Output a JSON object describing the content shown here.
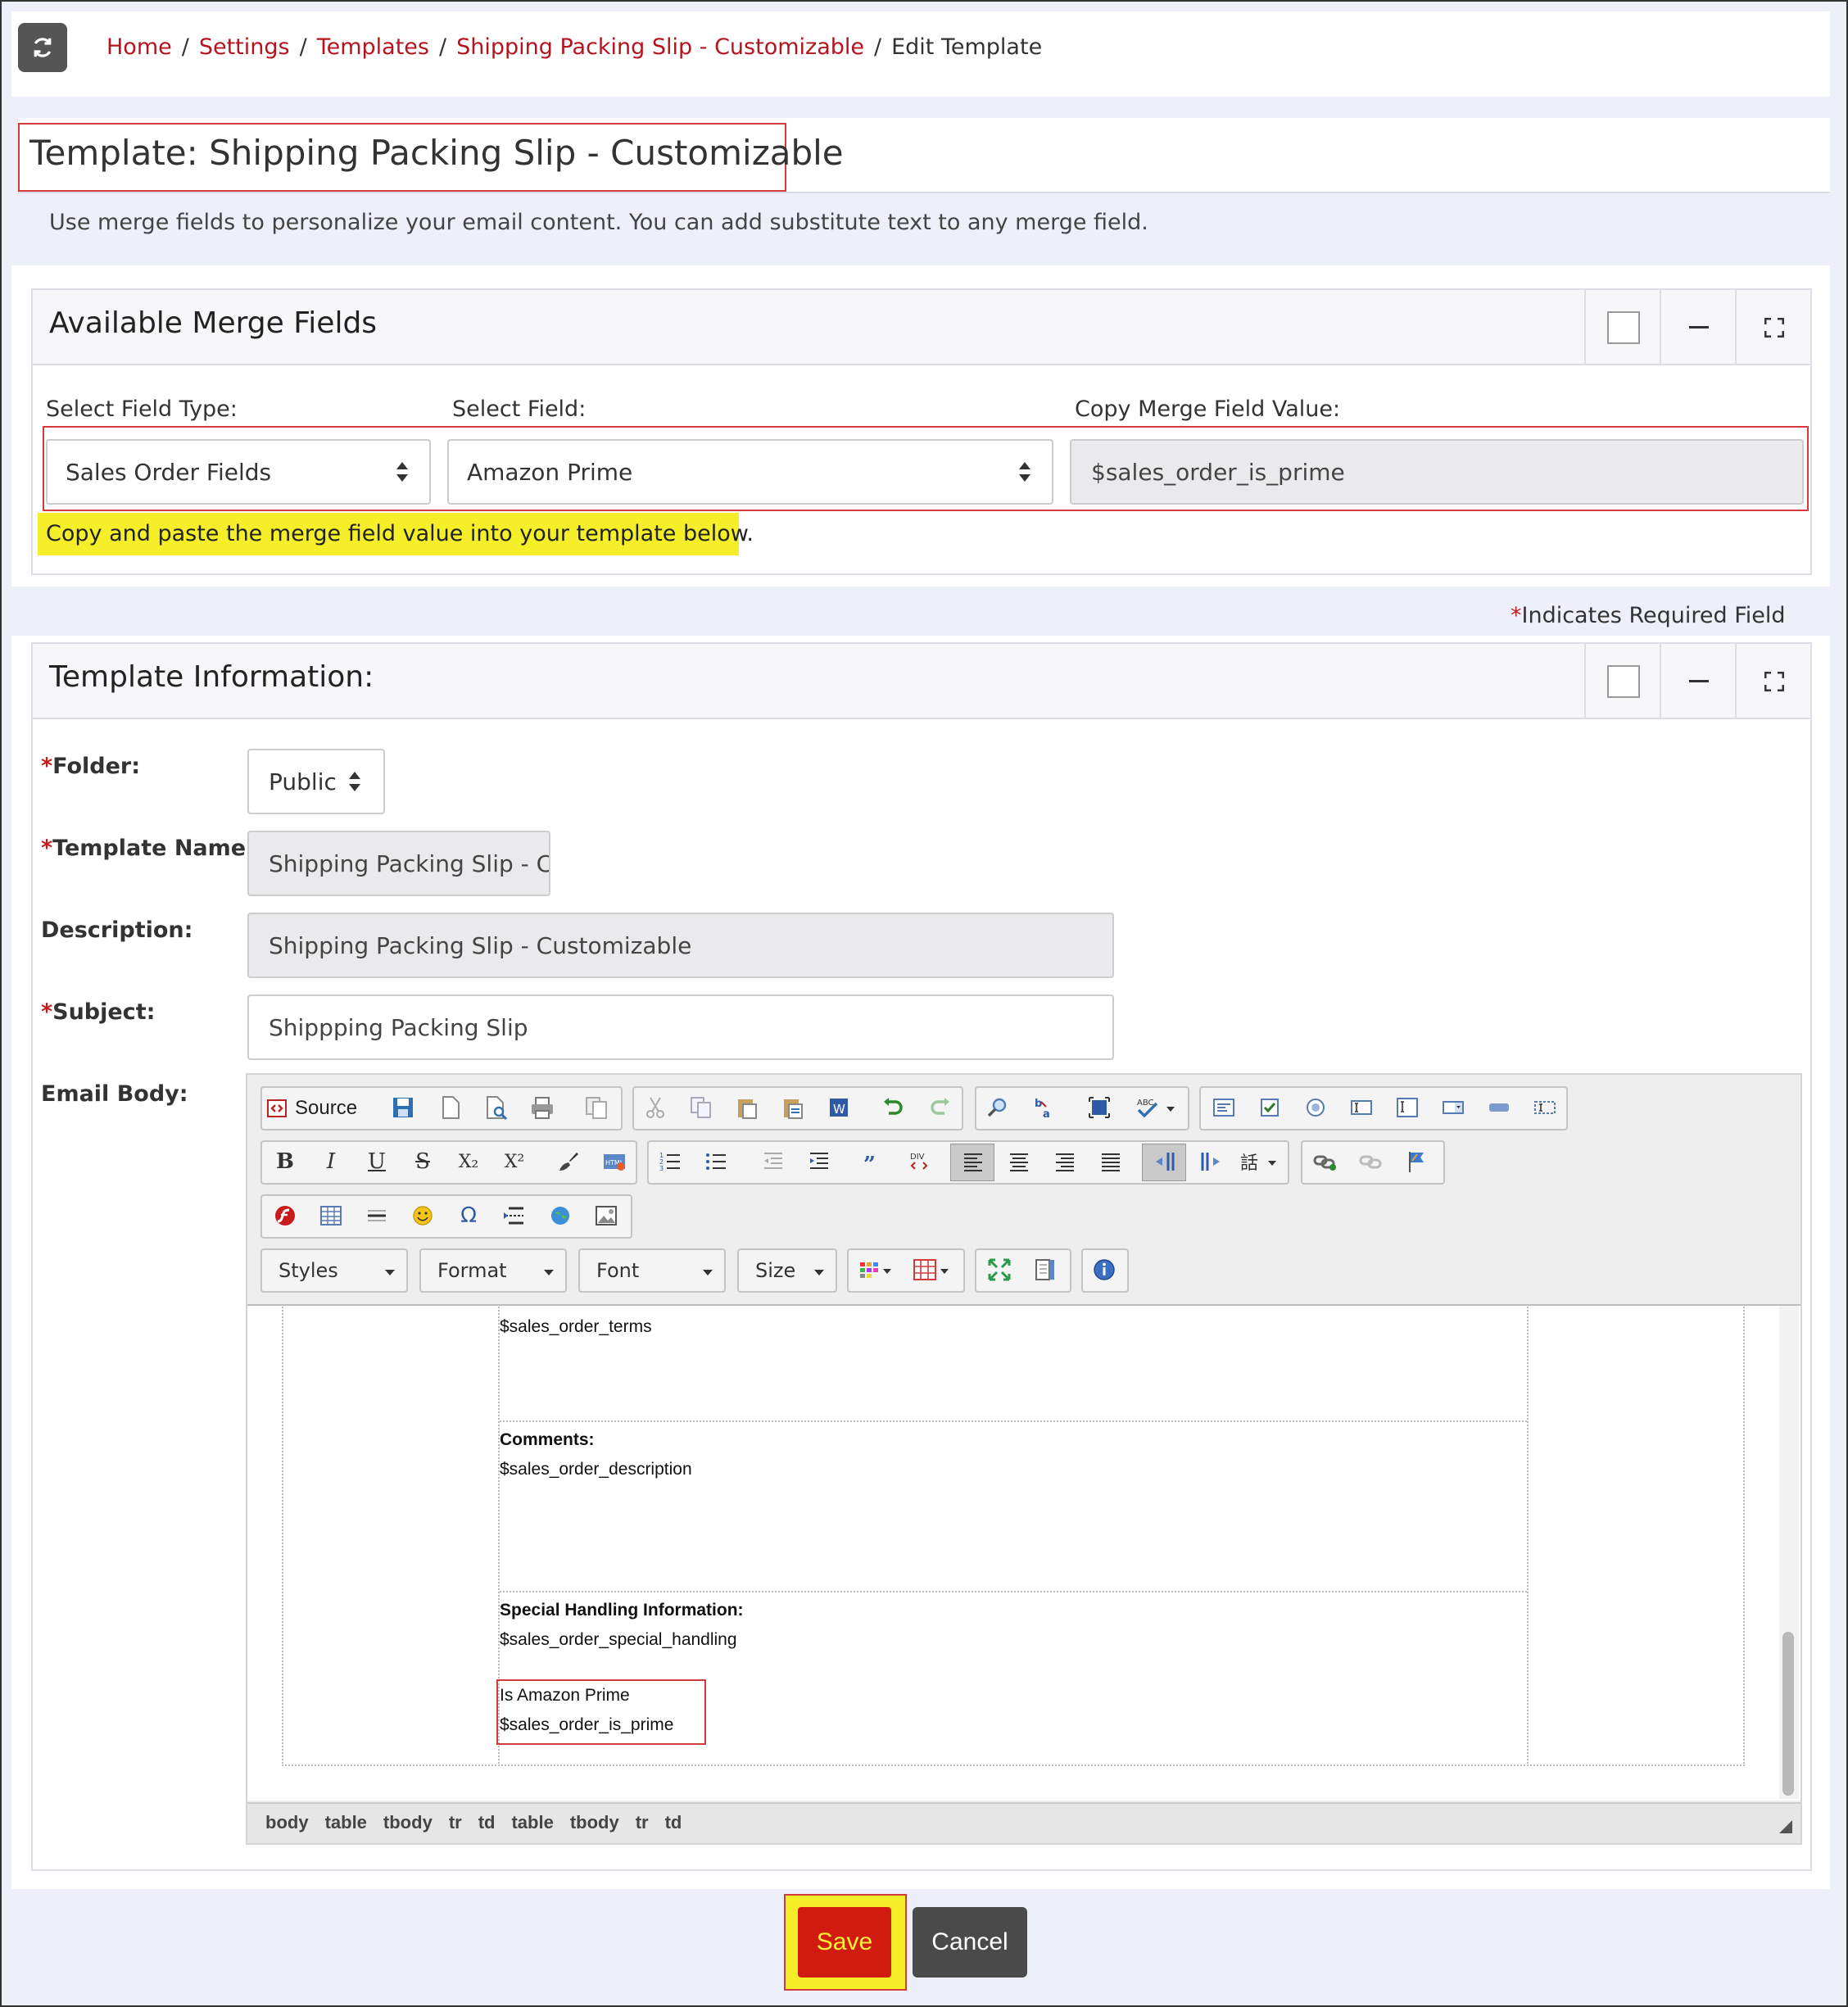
{
  "breadcrumb": {
    "items": [
      "Home",
      "Settings",
      "Templates",
      "Shipping Packing Slip - Customizable"
    ],
    "current": "Edit Template",
    "separator": "/"
  },
  "page": {
    "title": "Template: Shipping Packing Slip - Customizable",
    "intro": "Use merge fields to personalize your email content. You can add substitute text to any merge field."
  },
  "merge_panel": {
    "title": "Available Merge Fields",
    "field_type_label": "Select Field Type:",
    "field_type_value": "Sales Order Fields",
    "field_label": "Select Field:",
    "field_value": "Amazon Prime",
    "copy_label": "Copy Merge Field Value:",
    "copy_value": "$sales_order_is_prime",
    "hint": "Copy and paste the merge field value into your template below."
  },
  "required_note": {
    "asterisk": "*",
    "text": "Indicates Required Field"
  },
  "template_panel": {
    "title": "Template Information:",
    "folder_label": "Folder:",
    "folder_value": "Public",
    "name_label": "Template Name:",
    "name_value": "Shipping Packing Slip - Customizable",
    "description_label": "Description:",
    "description_value": "Shipping Packing Slip - Customizable",
    "subject_label": "Subject:",
    "subject_value": "Shippping Packing Slip",
    "body_label": "Email Body:",
    "required_mark": "*"
  },
  "editor": {
    "source_label": "Source",
    "styles_label": "Styles",
    "format_label": "Format",
    "font_label": "Font",
    "size_label": "Size",
    "bold_glyph": "B",
    "italic_glyph": "I",
    "underline_glyph": "U",
    "strike_glyph": "S",
    "sub_glyph": "X₂",
    "sup_glyph": "X²",
    "content": {
      "terms": "$sales_order_terms",
      "comments_label": "Comments:",
      "comments_value": "$sales_order_description",
      "special_label": "Special Handling Information:",
      "special_value": "$sales_order_special_handling",
      "prime_label": "Is Amazon Prime",
      "prime_value": "$sales_order_is_prime"
    },
    "path": [
      "body",
      "table",
      "tbody",
      "tr",
      "td",
      "table",
      "tbody",
      "tr",
      "td"
    ]
  },
  "actions": {
    "save_label": "Save",
    "cancel_label": "Cancel"
  },
  "colors": {
    "link": "#b5141f",
    "highlight": "#f5ef2a",
    "save_bg": "#d21b0f",
    "cancel_bg": "#4a4a4a",
    "annotation": "#d43a3a"
  }
}
